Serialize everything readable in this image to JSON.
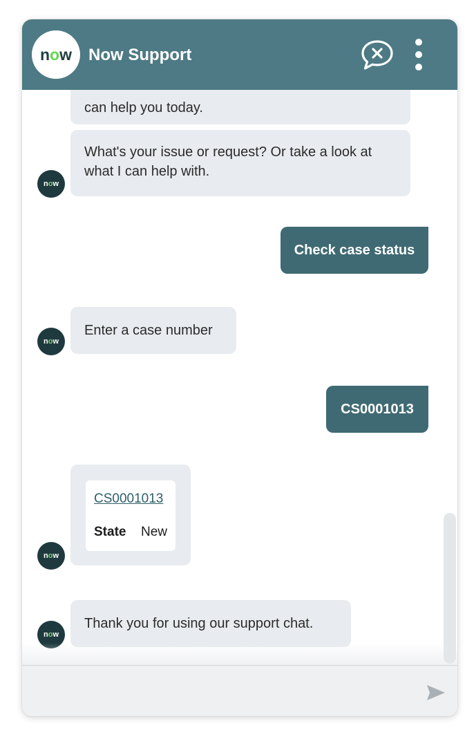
{
  "header": {
    "logo_prefix": "n",
    "logo_mid": "o",
    "logo_suffix": "w",
    "title": "Now Support",
    "end_chat_icon": "chat-close-icon",
    "menu_icon": "vertical-dots-icon"
  },
  "colors": {
    "header": "#4d7a84",
    "user_bubble": "#3f6a73",
    "bot_bubble": "#e8ebef",
    "accent_green": "#62d84e"
  },
  "messages": [
    {
      "from": "bot",
      "text": "can help you today."
    },
    {
      "from": "bot",
      "text": "What's your issue or request? Or take a look at what I can help with."
    },
    {
      "from": "user",
      "text": "Check case status"
    },
    {
      "from": "bot",
      "text": "Enter a case number"
    },
    {
      "from": "user",
      "text": "CS0001013"
    },
    {
      "from": "bot",
      "card": {
        "link": "CS0001013",
        "state_label": "State",
        "state_value": "New"
      }
    },
    {
      "from": "bot",
      "text": "Thank you for using our support chat."
    }
  ],
  "avatar": {
    "prefix": "n",
    "mid": "o",
    "suffix": "w"
  },
  "composer": {
    "value": "",
    "send_icon": "send-arrow-icon"
  }
}
